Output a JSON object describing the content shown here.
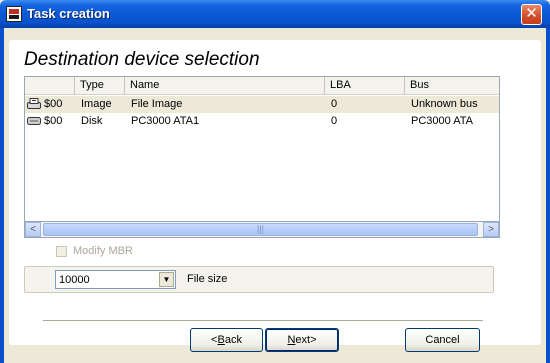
{
  "window": {
    "title": "Task creation",
    "close_glyph": "✕"
  },
  "heading": "Destination device selection",
  "list": {
    "columns": [
      "",
      "Type",
      "Name",
      "LBA",
      "Bus"
    ],
    "rows": [
      {
        "id": "$00",
        "type": "Image",
        "name": "File Image",
        "lba": "0",
        "bus": "Unknown bus",
        "icon": "image-drive-icon"
      },
      {
        "id": "$00",
        "type": "Disk",
        "name": "PC3000 ATA1",
        "lba": "0",
        "bus": "PC3000 ATA",
        "icon": "disk-drive-icon"
      }
    ],
    "scroll_left": "<",
    "scroll_right": ">",
    "thumb_grip": "|||"
  },
  "modify_mbr": {
    "label": "Modify MBR",
    "checked": false,
    "enabled": false
  },
  "file_size": {
    "value": "10000",
    "label": "File size"
  },
  "buttons": {
    "back": {
      "mnemonic": "B",
      "rest": "ack",
      "prefix": "<"
    },
    "next": {
      "mnemonic": "N",
      "rest": "ext>"
    },
    "cancel": "Cancel"
  },
  "colors": {
    "titlebar": "#0a52cc",
    "dialog_bg": "#ece9d8",
    "close_button": "#d4502c"
  }
}
